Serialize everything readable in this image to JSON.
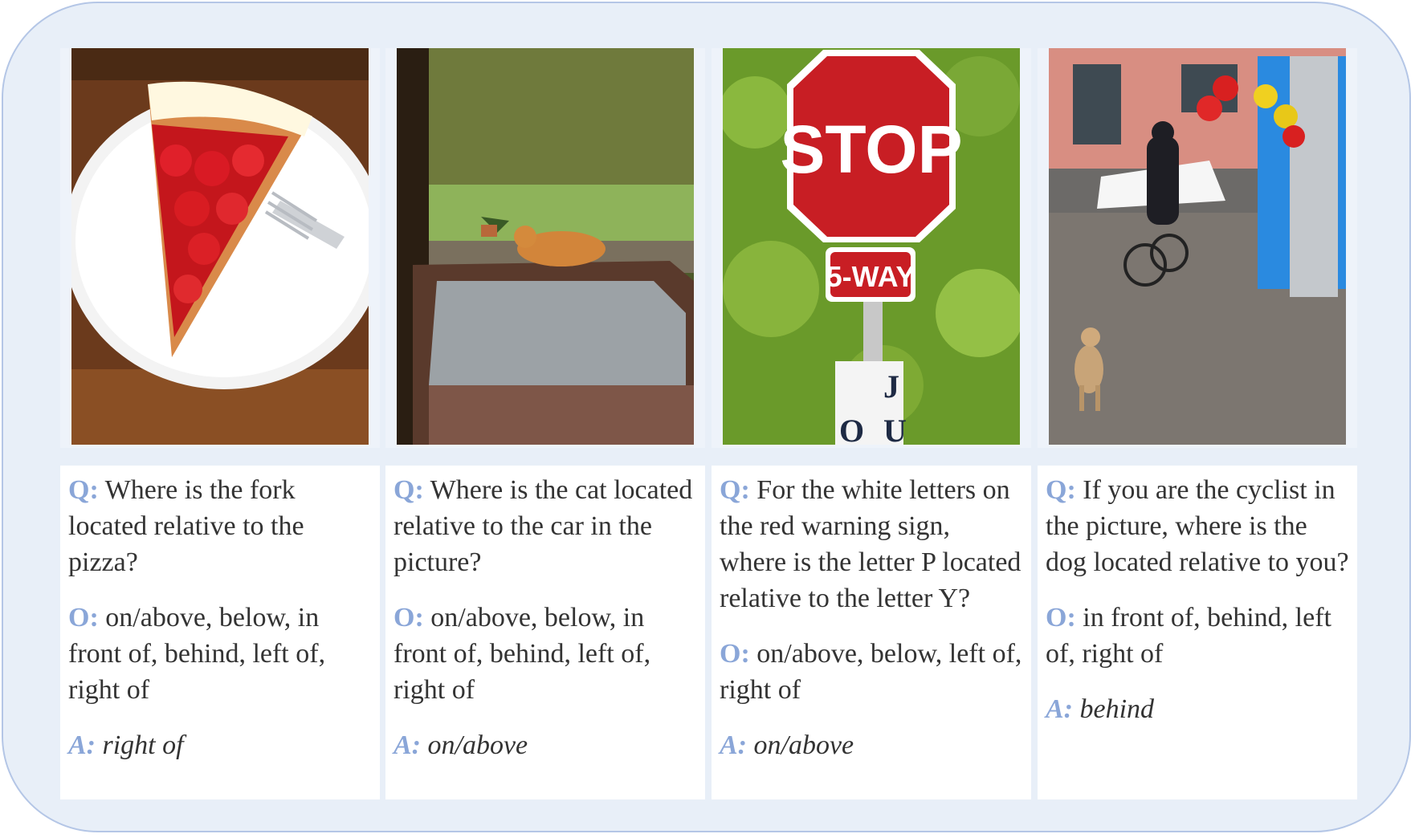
{
  "colors": {
    "background": "#e8eff8",
    "border": "#b4c6e6",
    "label": "#8aa6d8",
    "text": "#333333"
  },
  "cards": [
    {
      "image": "strawberry-tart-with-fork-on-plate",
      "q_label": "Q:",
      "question": "Where is the fork located relative to the pizza?",
      "o_label": "O:",
      "options": "on/above, below, in front of, behind, left of, right of",
      "a_label": "A:",
      "answer": "right of"
    },
    {
      "image": "orange-cat-on-car-roof",
      "q_label": "Q:",
      "question": "Where is the cat located relative to the car in the picture?",
      "o_label": "O:",
      "options": "on/above, below, in front of, behind, left of, right of",
      "a_label": "A:",
      "answer": "on/above"
    },
    {
      "image": "stop-sign-with-5-way-sign",
      "sign_text": "STOP",
      "subsign_text": "5-WAY",
      "post_text_1": "J",
      "post_text_2": "U",
      "post_text_3": "O",
      "q_label": "Q:",
      "question": "For the white letters on the red warning sign, where is the letter P located relative to the letter Y?",
      "o_label": "O:",
      "options": "on/above, below, left of, right of",
      "a_label": "A:",
      "answer": "on/above"
    },
    {
      "image": "street-cyclist-and-dog",
      "q_label": "Q:",
      "question": "If you are the cyclist in the picture, where is the dog located relative to you?",
      "o_label": "O:",
      "options": "in front of, behind, left of, right of",
      "a_label": "A:",
      "answer": "behind"
    }
  ]
}
